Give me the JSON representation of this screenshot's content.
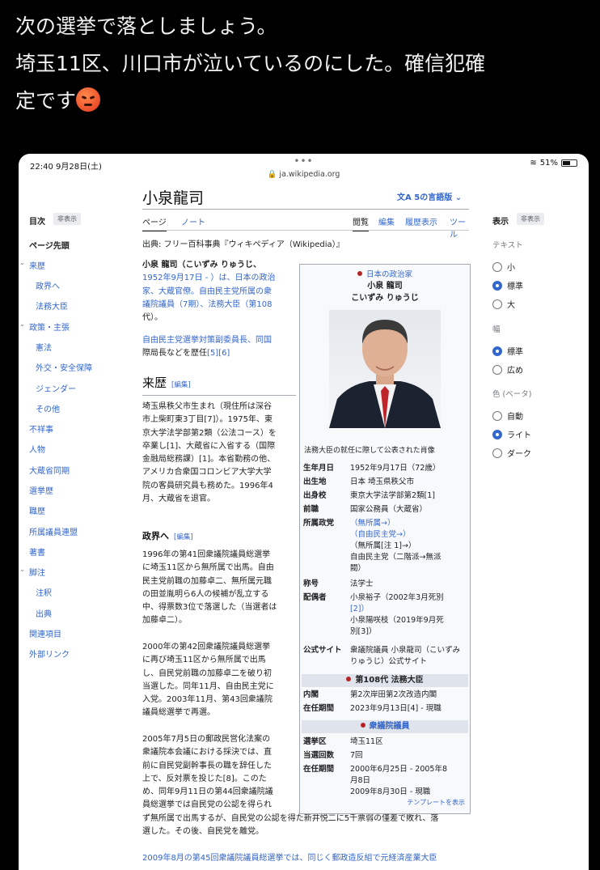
{
  "tweet": {
    "line1": "次の選挙で落としましょう。",
    "line2": "埼玉11区、川口市が泣いているのにした。確信犯確",
    "line3": "定です",
    "emoji": "angry-face-emoji"
  },
  "status_bar": {
    "time": "22:40  9月28日(土)",
    "dots": "•••",
    "url": "ja.wikipedia.org",
    "battery": "51%"
  },
  "article": {
    "title": "小泉龍司",
    "lang_button": "5の言語版",
    "tab_page": "ページ",
    "tab_note": "ノート",
    "tab_read": "閲覧",
    "tab_edit": "編集",
    "tab_history": "履歴表示",
    "tab_tools": "ツール"
  },
  "toc": {
    "heading": "目次",
    "hide_button": "非表示",
    "items": [
      "ページ先頭",
      "来歴",
      "政界へ",
      "法務大臣",
      "政策・主張",
      "憲法",
      "外交・安全保障",
      "ジェンダー",
      "その他",
      "不祥事",
      "人物",
      "大蔵省同期",
      "選挙歴",
      "職歴",
      "所属議員連盟",
      "著書",
      "脚注",
      "注釈",
      "出典",
      "関連項目",
      "外部リンク"
    ]
  },
  "display_panel": {
    "heading": "表示",
    "hide_button": "非表示",
    "text_label": "テキスト",
    "text_options": [
      "小",
      "標準",
      "大"
    ],
    "width_label": "幅",
    "width_options": [
      "標準",
      "広め"
    ],
    "color_label": "色 (ベータ)",
    "color_options": [
      "自動",
      "ライト",
      "ダーク"
    ]
  },
  "body": {
    "source": "出典: フリー百科事典『ウィキペディア（Wikipedia）』",
    "intro_a": "小泉 龍司（こいずみ りゅうじ、",
    "intro_b": "1952年9月17日 - ）は、日本の政治",
    "intro_c": "家、大蔵官僚。自由民主党所属の衆",
    "intro_d": "議院議員（7期）、法務大臣（第108",
    "intro_e": "代）。",
    "intro2_a": "自由民主党選挙対策副委員長、同国",
    "intro2_b": "際局長などを歴任",
    "intro2_refs": "[5][6]",
    "h_career": "来歴",
    "edit_label": "[編集]",
    "career": [
      "埼玉県秩父市生まれ（現住所は深谷",
      "市上柴町東3丁目[7]）。1975年、東",
      "京大学法学部第2類（公法コース）を",
      "卒業し[1]、大蔵省に入省する（国際",
      "金融局総務課）[1]。本省勤務の他、",
      "アメリカ合衆国コロンビア大学大学",
      "院の客員研究員も務めた。1996年4",
      "月、大蔵省を退官。"
    ],
    "h_politics": "政界へ",
    "politics1": [
      "1996年の第41回衆議院議員総選挙",
      "に埼玉11区から無所属で出馬。自由",
      "民主党前職の加藤卓二、無所属元職",
      "の田並胤明ら6人の候補が乱立する",
      "中、得票数3位で落選した（当選者は",
      "加藤卓二）。"
    ],
    "politics2": [
      "2000年の第42回衆議院議員総選挙",
      "に再び埼玉11区から無所属で出馬",
      "し、自民党前職の加藤卓二を破り初",
      "当選した。同年11月、自由民主党に",
      "入党。2003年11月、第43回衆議院",
      "議員総選挙で再選。"
    ],
    "politics3": [
      "2005年7月5日の郵政民営化法案の",
      "衆議院本会議における採決では、直",
      "前に自民党副幹事長の職を辞任した",
      "上で、反対票を投じた[8]。このた",
      "め、同年9月11日の第44回衆議院議",
      "員総選挙では自民党の公認を得られ"
    ],
    "politics3_wide": [
      "ず無所属で出馬するが、自民党の公認を得た新井悦二に5千票弱の僅差で敗れ、落",
      "選した。その後、自民党を離党。"
    ],
    "politics4_cut": "2009年8月の第45回衆議院議員総選挙では、同じく郵政造反組で元経済産業大臣"
  },
  "infobox": {
    "header_small": "日本の政治家",
    "name": "小泉 龍司",
    "kana": "こいずみ りゅうじ",
    "caption": "法務大臣の就任に際して公表された肖像",
    "rows": [
      {
        "k": "生年月日",
        "v": "1952年9月17日（72歳）"
      },
      {
        "k": "出生地",
        "v": "日本 埼玉県秩父市"
      },
      {
        "k": "出身校",
        "v": "東京大学法学部第2類[1]"
      },
      {
        "k": "前職",
        "v": "国家公務員（大蔵省）"
      },
      {
        "k": "所属政党",
        "v": "（無所属→）"
      }
    ],
    "party_more": [
      "（自由民主党→）",
      "（無所属[注 1]→）",
      "自由民主党（二階派→無派",
      "閥）"
    ],
    "title_k": "称号",
    "title_v": "法学士",
    "spouse_k": "配偶者",
    "spouse_v1": [
      "小泉裕子（2002年3月死別",
      "[2]）"
    ],
    "spouse_v2": [
      "小泉陽咲枝（2019年9月死",
      "別[3]）"
    ],
    "site_k": "公式サイト",
    "site_v": [
      "衆議院議員 小泉龍司（こいずみ",
      "りゅうじ）公式サイト"
    ],
    "band1": "第108代 法務大臣",
    "cabinet_k": "内閣",
    "cabinet_v": "第2次岸田第2次改造内閣",
    "term_k": "在任期間",
    "term_v": "2023年9月13日[4] - 現職",
    "band2": "衆議院議員",
    "district_k": "選挙区",
    "district_v": "埼玉11区",
    "wins_k": "当選回数",
    "wins_v": "7回",
    "term2_k": "在任期間",
    "term2_v": [
      "2000年6月25日 - 2005年8",
      "月8日",
      "2009年8月30日 - 現職"
    ],
    "template_link": "テンプレートを表示"
  }
}
